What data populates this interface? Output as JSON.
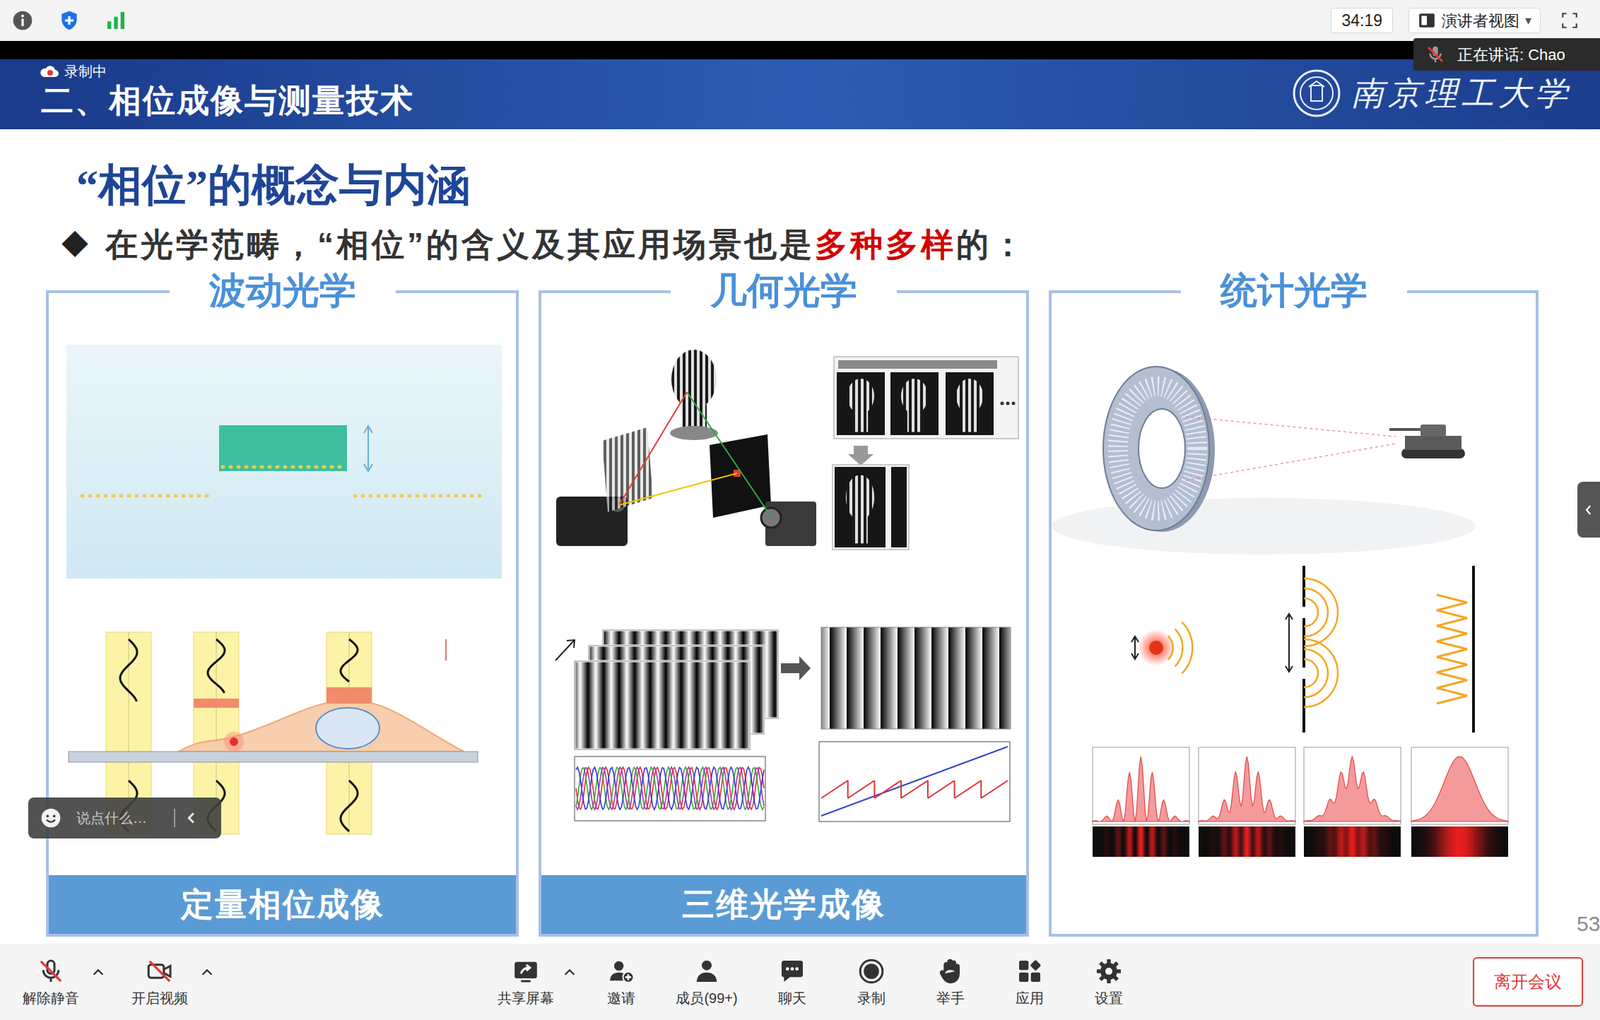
{
  "top_bar": {
    "timer": "34:19",
    "view_mode": "演讲者视图",
    "view_menu": "▾"
  },
  "speaking": {
    "label": "正在讲话: Chao",
    "muted": true
  },
  "recording": {
    "label": "录制中",
    "on": true
  },
  "slide": {
    "section": "二、相位成像与测量技术",
    "university": "南京理工大学",
    "title": "“相位”的概念与内涵",
    "bullet_marker": "◆",
    "bullet": [
      {
        "text": "在光学范畴，“相位”的含义及其应用场景也是",
        "highlight": false
      },
      {
        "text": "多种多样",
        "highlight": true
      },
      {
        "text": "的：",
        "highlight": false
      }
    ],
    "panels": [
      {
        "title": "波动光学",
        "caption": "定量相位成像",
        "kind": "wave"
      },
      {
        "title": "几何光学",
        "caption": "三维光学成像",
        "kind": "geometric"
      },
      {
        "title": "统计光学",
        "kind": "statistical"
      }
    ],
    "page_number": "53"
  },
  "chat_input": {
    "placeholder": "说点什么…"
  },
  "toolbar": {
    "items": [
      {
        "label": "解除静音",
        "kind": "mic",
        "has_menu": true,
        "off": true
      },
      {
        "label": "开启视频",
        "kind": "video",
        "has_menu": true,
        "off": true
      },
      {
        "label": "共享屏幕",
        "kind": "share",
        "has_menu": true,
        "off": false
      },
      {
        "label": "邀请",
        "kind": "invite",
        "has_menu": false,
        "off": false
      },
      {
        "label": "成员(99+)",
        "kind": "members",
        "has_menu": false,
        "off": false
      },
      {
        "label": "聊天",
        "kind": "chat",
        "has_menu": false,
        "off": false
      },
      {
        "label": "录制",
        "kind": "record",
        "has_menu": false,
        "off": false
      },
      {
        "label": "举手",
        "kind": "hand",
        "has_menu": false,
        "off": false
      },
      {
        "label": "应用",
        "kind": "apps",
        "has_menu": false,
        "off": false
      },
      {
        "label": "设置",
        "kind": "settings",
        "has_menu": false,
        "off": false
      }
    ],
    "leave": "离开会议"
  }
}
